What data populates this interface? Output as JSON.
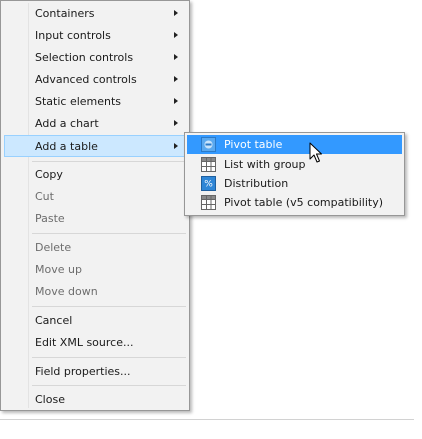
{
  "main_menu": {
    "items": [
      {
        "label": "Containers",
        "submenu": true
      },
      {
        "label": "Input controls",
        "submenu": true
      },
      {
        "label": "Selection controls",
        "submenu": true
      },
      {
        "label": "Advanced controls",
        "submenu": true
      },
      {
        "label": "Static elements",
        "submenu": true
      },
      {
        "label": "Add a chart",
        "submenu": true
      },
      {
        "label": "Add a table",
        "submenu": true,
        "active": true
      }
    ],
    "copy": "Copy",
    "cut": "Cut",
    "paste": "Paste",
    "delete": "Delete",
    "move_up": "Move up",
    "move_down": "Move down",
    "cancel": "Cancel",
    "edit_xml": "Edit XML source...",
    "field_properties": "Field properties...",
    "close": "Close"
  },
  "sub_menu": {
    "items": [
      {
        "label": "Pivot table",
        "icon": "pivot-table-icon",
        "highlighted": true
      },
      {
        "label": "List with group",
        "icon": "list-grid-icon"
      },
      {
        "label": "Distribution",
        "icon": "distribution-icon"
      },
      {
        "label": "Pivot table (v5 compatibility)",
        "icon": "pivot-table-v5-icon"
      }
    ]
  },
  "colors": {
    "highlight": "#3399ff",
    "active_item_bg": "#cce8ff",
    "menu_bg": "#f2f2f2"
  }
}
